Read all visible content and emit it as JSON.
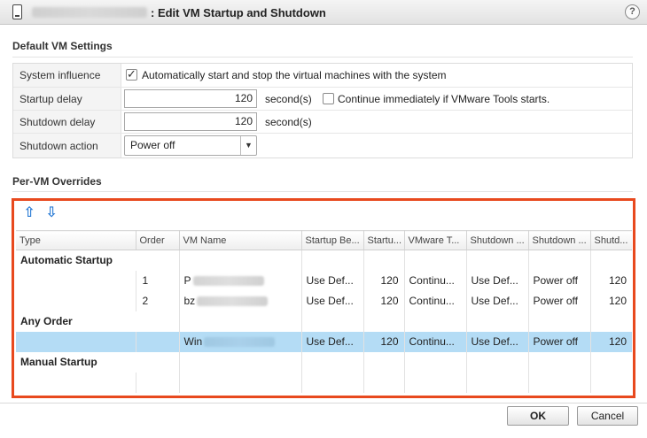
{
  "window": {
    "title": ": Edit VM Startup and Shutdown",
    "help_symbol": "?"
  },
  "default_settings": {
    "section_title": "Default VM Settings",
    "system_influence": {
      "label": "System influence",
      "checked": true,
      "text": "Automatically start and stop the virtual machines with the system"
    },
    "startup_delay": {
      "label": "Startup delay",
      "value": "120",
      "unit": "second(s)",
      "continue_checked": false,
      "continue_text": "Continue immediately if VMware Tools starts."
    },
    "shutdown_delay": {
      "label": "Shutdown delay",
      "value": "120",
      "unit": "second(s)"
    },
    "shutdown_action": {
      "label": "Shutdown action",
      "value": "Power off"
    }
  },
  "overrides": {
    "section_title": "Per-VM Overrides",
    "columns": [
      "Type",
      "Order",
      "VM Name",
      "Startup Be...",
      "Startu...",
      "VMware T...",
      "Shutdown ...",
      "Shutdown ...",
      "Shutd..."
    ],
    "groups": {
      "automatic": "Automatic Startup",
      "any": "Any Order",
      "manual": "Manual Startup"
    },
    "rows": [
      {
        "order": "1",
        "vm": "P",
        "startup_behavior": "Use Def...",
        "startup_delay": "120",
        "vmware_tools": "Continu...",
        "shutdown_behavior": "Use Def...",
        "shutdown_action": "Power off",
        "shutdown_delay": "120"
      },
      {
        "order": "2",
        "vm": "bz",
        "startup_behavior": "Use Def...",
        "startup_delay": "120",
        "vmware_tools": "Continu...",
        "shutdown_behavior": "Use Def...",
        "shutdown_action": "Power off",
        "shutdown_delay": "120"
      },
      {
        "order": "",
        "vm": "Win",
        "startup_behavior": "Use Def...",
        "startup_delay": "120",
        "vmware_tools": "Continu...",
        "shutdown_behavior": "Use Def...",
        "shutdown_action": "Power off",
        "shutdown_delay": "120"
      }
    ]
  },
  "buttons": {
    "ok": "OK",
    "cancel": "Cancel"
  },
  "colors": {
    "highlight_border": "#e8491e",
    "selected_row": "#b4dcf5",
    "arrow_blue": "#2a7bd5"
  }
}
